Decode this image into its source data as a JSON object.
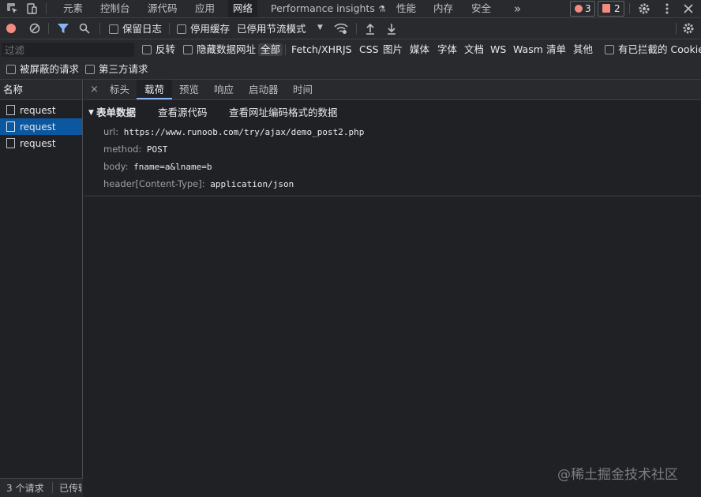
{
  "top_tabs": [
    "元素",
    "控制台",
    "源代码",
    "应用",
    "网络",
    "Performance insights",
    "性能",
    "内存",
    "安全"
  ],
  "more_tabs": "»",
  "errors_count": "3",
  "issues_count": "2",
  "toolbar": {
    "preserve_log": "保留日志",
    "disable_cache": "停用缓存",
    "throttling": "已停用节流模式"
  },
  "filter": {
    "placeholder": "过滤",
    "invert": "反转",
    "hide_data_urls": "隐藏数据网址",
    "types": [
      "全部",
      "Fetch/XHR",
      "JS",
      "CSS",
      "图片",
      "媒体",
      "字体",
      "文档",
      "WS",
      "Wasm",
      "清单",
      "其他"
    ],
    "blocked_cookies": "有已拦截的 Cookie",
    "blocked_requests": "被屏蔽的请求",
    "third_party": "第三方请求"
  },
  "name_header": "名称",
  "requests": [
    "request",
    "request",
    "request"
  ],
  "detail_tabs": [
    "标头",
    "载荷",
    "预览",
    "响应",
    "启动器",
    "时间"
  ],
  "payload": {
    "section_title": "表单数据",
    "view_source": "查看源代码",
    "view_url_encoded": "查看网址编码格式的数据",
    "fields": [
      {
        "key": "url:",
        "value": "https://www.runoob.com/try/ajax/demo_post2.php"
      },
      {
        "key": "method:",
        "value": "POST"
      },
      {
        "key": "body:",
        "value": "fname=a&lname=b"
      },
      {
        "key": "header[Content-Type]:",
        "value": "application/json"
      }
    ]
  },
  "status": {
    "requests_count": "3 个请求",
    "transferred": "已传输"
  },
  "watermark": "@稀土掘金技术社区",
  "colors": {
    "accent": "#8ab4f8",
    "selected_row": "#0b57a0",
    "record": "#f28b82"
  }
}
